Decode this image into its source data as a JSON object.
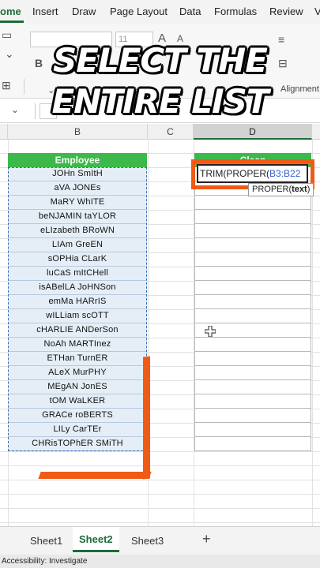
{
  "ribbon": {
    "tabs": [
      {
        "label": "ome",
        "active": true
      },
      {
        "label": "Insert"
      },
      {
        "label": "Draw"
      },
      {
        "label": "Page Layout"
      },
      {
        "label": "Data"
      },
      {
        "label": "Formulas"
      },
      {
        "label": "Review"
      },
      {
        "label": "V"
      }
    ],
    "font_size": "11",
    "alignment_label": "Alignment"
  },
  "headline": {
    "line1": "SELECT THE",
    "line2": "ENTIRE LIST"
  },
  "columns": {
    "b": "B",
    "c": "C",
    "d": "D"
  },
  "employee": {
    "header": "Employee",
    "names": [
      "JOHn SmItH",
      "aVA JONEs",
      "MaRY WhITE",
      "beNJAMIN taYLOR",
      "eLIzabeth BRoWN",
      "LIAm GreEN",
      "sOPHia CLarK",
      "luCaS mItCHell",
      "isABelLA JoHNSon",
      "emMa HARrIS",
      "wILLiam scOTT",
      "cHARLIE ANDerSon",
      "NoAh MARTInez",
      "ETHan TurnER",
      "ALeX MurPHY",
      "MEgAN JonES",
      "tOM WaLKER",
      "GRACe roBERTS",
      "LILy CarTEr",
      "CHRisTOPhER SMiTH"
    ]
  },
  "clean": {
    "header": "Clean",
    "formula_prefix": "TRIM(PROPER(",
    "formula_ref": "B3:B22",
    "tooltip_fn": "PROPER(",
    "tooltip_arg": "text",
    "tooltip_end": ")"
  },
  "sheets": {
    "tabs": [
      "Sheet1",
      "Sheet2",
      "Sheet3"
    ],
    "active_index": 1,
    "add": "+"
  },
  "status": {
    "text": "Accessibility: Investigate"
  },
  "colors": {
    "header_green": "#3cb94a",
    "excel_green": "#1e6b3a",
    "accent_orange": "#f05a14",
    "selection_blue": "#3a6fb0"
  }
}
